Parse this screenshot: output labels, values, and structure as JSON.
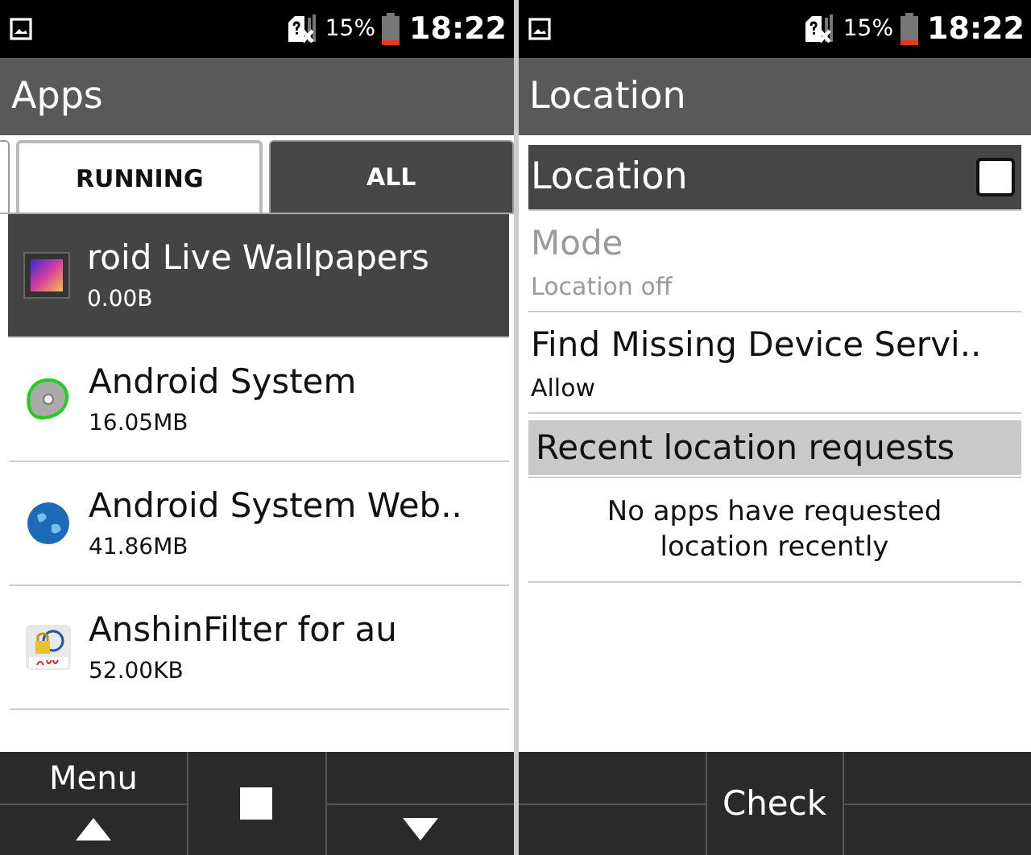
{
  "apps_screen": {
    "status": {
      "battery": "15%",
      "time": "18:22"
    },
    "title": "Apps",
    "tabs": [
      {
        "label": "RUNNING",
        "selected": true
      },
      {
        "label": "ALL",
        "selected": false
      }
    ],
    "apps": [
      {
        "name": "roid Live Wallpapers",
        "size": "0.00B",
        "selected": true
      },
      {
        "name": "Android System",
        "size": "16.05MB",
        "selected": false
      },
      {
        "name": "Android System Web..",
        "size": "41.86MB",
        "selected": false
      },
      {
        "name": "AnshinFilter for au",
        "size": "52.00KB",
        "selected": false
      }
    ],
    "softkeys": {
      "left": "Menu"
    }
  },
  "location_screen": {
    "status": {
      "battery": "15%",
      "time": "18:22"
    },
    "title": "Location",
    "toggle": {
      "label": "Location",
      "checked": false,
      "selected": true
    },
    "settings": [
      {
        "title": "Mode",
        "summary": "Location off",
        "disabled": true
      },
      {
        "title": "Find Missing Device Servi..",
        "summary": "Allow",
        "disabled": false
      }
    ],
    "section_header": "Recent location requests",
    "empty_message": "No apps have requested location recently",
    "softkeys": {
      "center": "Check"
    }
  }
}
